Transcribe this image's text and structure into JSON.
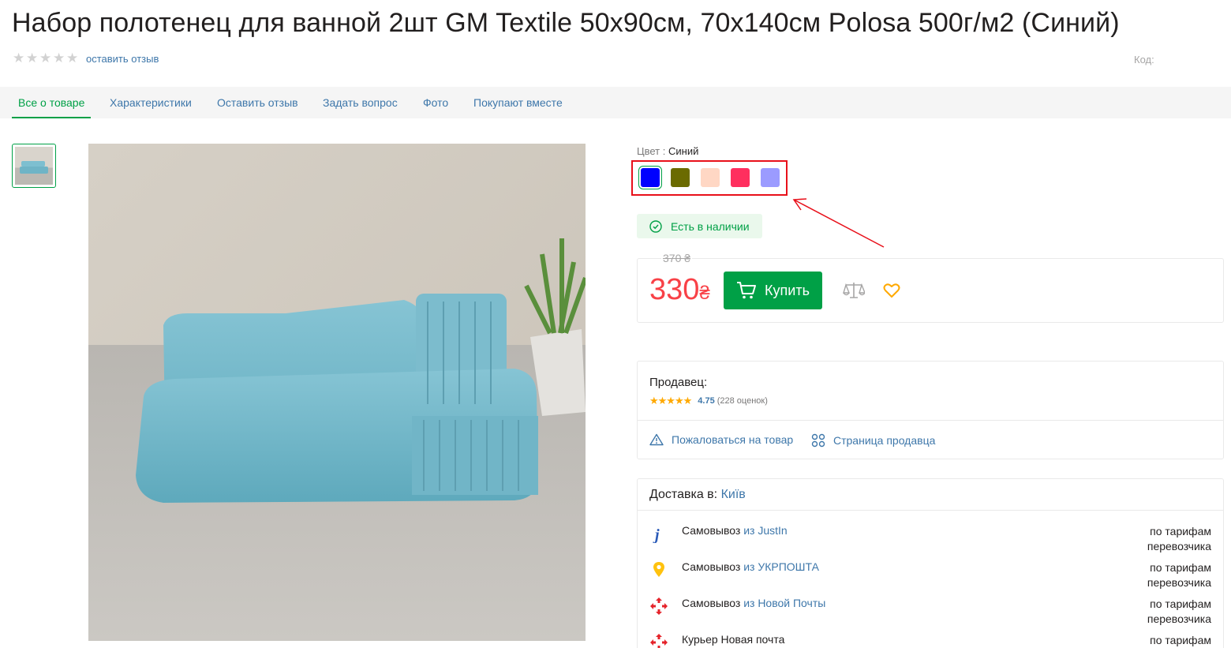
{
  "product": {
    "title": "Набор полотенец для ванной 2шт GM Textile 50x90см, 70x140см Polosa 500г/м2 (Синий)",
    "review_link": "оставить отзыв",
    "code_label": "Код:",
    "rating_stars": 0
  },
  "tabs": [
    {
      "label": "Все о товаре"
    },
    {
      "label": "Характеристики"
    },
    {
      "label": "Оставить отзыв"
    },
    {
      "label": "Задать вопрос"
    },
    {
      "label": "Фото"
    },
    {
      "label": "Покупают вместе"
    }
  ],
  "color": {
    "label": "Цвет",
    "selected": "Синий",
    "swatches": [
      "#0000ff",
      "#6b6b00",
      "#ffd7c4",
      "#ff2f5e",
      "#9b9bff"
    ]
  },
  "stock": {
    "text": "Есть в наличии"
  },
  "price": {
    "old": "370 ₴",
    "current": "330",
    "currency": "₴",
    "buy_label": "Купить"
  },
  "seller": {
    "title": "Продавец:",
    "rating": "4.75",
    "reviews": "(228 оценок)",
    "complain": "Пожаловаться на товар",
    "page": "Страница продавца"
  },
  "delivery": {
    "title": "Доставка в:",
    "city": "Київ",
    "rows": [
      {
        "name": "Самовывоз ",
        "link": "из JustIn",
        "price": "по тарифам перевозчика",
        "icon": "justin-icon"
      },
      {
        "name": "Самовывоз ",
        "link": "из УКРПОШТА",
        "price": "по тарифам перевозчика",
        "icon": "ukrposhta-icon"
      },
      {
        "name": "Самовывоз ",
        "link": "из Новой Почты",
        "price": "по тарифам перевозчика",
        "icon": "novaposhta-icon"
      },
      {
        "name": "Курьер Новая почта",
        "link": "",
        "price": "по тарифам",
        "icon": "novaposhta-courier-icon"
      }
    ]
  },
  "colors": {
    "accent_green": "#00a046",
    "link_blue": "#3e77aa",
    "price_red": "#f84147",
    "annotation_red": "#e8101a"
  }
}
